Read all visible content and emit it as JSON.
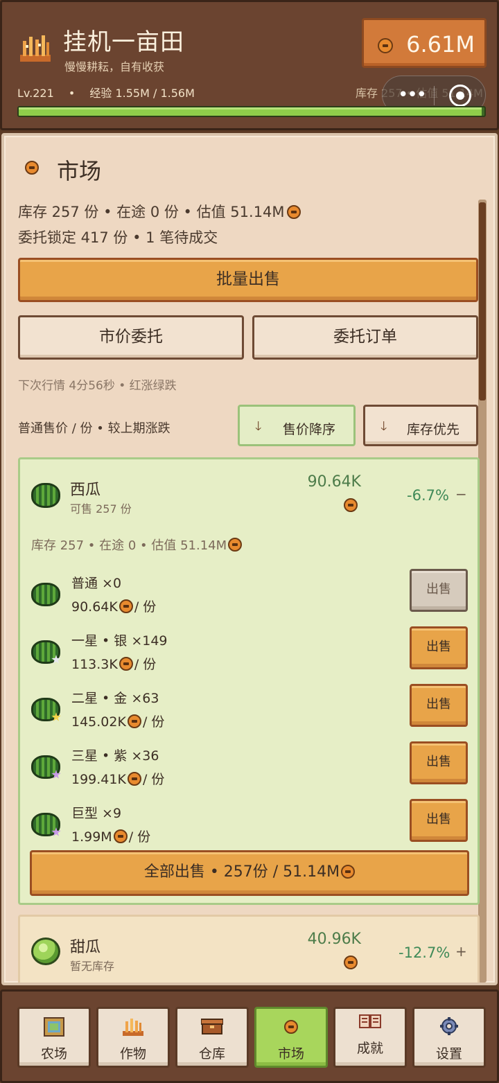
{
  "header": {
    "title": "挂机一亩田",
    "subtitle": "慢慢耕耘，自有收获",
    "coins": "6.61M",
    "level": "Lv.221",
    "dot": "•",
    "exp": "经验 1.55M / 1.56M",
    "exp_progress": 0.994,
    "stock_mini": "库存 257 • 估值 51.14M",
    "capsule_dots": "•••",
    "logo_icon": "wheat-icon"
  },
  "market": {
    "title": "市场",
    "summary_line1": "库存 257 份 • 在途 0 份 • 估值 51.14M",
    "summary_line2": "委托锁定 417 份 • 1 笔待成交",
    "bulk_sell": "批量出售",
    "market_order": "市价委托",
    "order_list": "委托订单",
    "next_quote": "下次行情 4分56秒 • 红涨绿跌",
    "sort_label": "普通售价 / 份 • 较上期涨跌",
    "sort_price_desc": "售价降序",
    "sort_stock_first": "库存优先",
    "sort_arrow": "🡓"
  },
  "products": [
    {
      "name": "西瓜",
      "sub": "可售 257 份",
      "price": "90.64K",
      "change": "-6.7%",
      "toggle": "−",
      "detail": "库存 257 • 在途 0 • 估值 51.14M",
      "grades": [
        {
          "name": "普通 ×0",
          "price": "90.64K",
          "unit": "/ 份",
          "sell": "出售",
          "star_color": ""
        },
        {
          "name": "一星 • 银 ×149",
          "price": "113.3K",
          "unit": "/ 份",
          "sell": "出售",
          "star_color": "#e8e8f0"
        },
        {
          "name": "二星 • 金 ×63",
          "price": "145.02K",
          "unit": "/ 份",
          "sell": "出售",
          "star_color": "#f4d24a"
        },
        {
          "name": "三星 • 紫 ×36",
          "price": "199.41K",
          "unit": "/ 份",
          "sell": "出售",
          "star_color": "#c89ae8"
        },
        {
          "name": "巨型 ×9",
          "price": "1.99M",
          "unit": "/ 份",
          "sell": "出售",
          "star_color": "#c89ae8"
        }
      ],
      "sell_all": "全部出售 • 257份 / 51.14M"
    },
    {
      "name": "甜瓜",
      "sub": "暂无库存",
      "price": "40.96K",
      "change": "-12.7%",
      "toggle": "+"
    }
  ],
  "nav": [
    {
      "label": "农场",
      "icon": "farm-icon"
    },
    {
      "label": "作物",
      "icon": "crops-icon"
    },
    {
      "label": "仓库",
      "icon": "warehouse-icon"
    },
    {
      "label": "市场",
      "icon": "market-coin-icon",
      "active": true
    },
    {
      "label": "成就",
      "icon": "achievement-book-icon"
    },
    {
      "label": "设置",
      "icon": "settings-gear-icon"
    }
  ],
  "colors": {
    "header_bg": "#6b4430",
    "panel_bg": "#eed8c2",
    "accent_orange": "#e8a449",
    "card_green": "#e6eec6",
    "active_tab": "#a8d65c",
    "price_green": "#4d7c4a"
  }
}
